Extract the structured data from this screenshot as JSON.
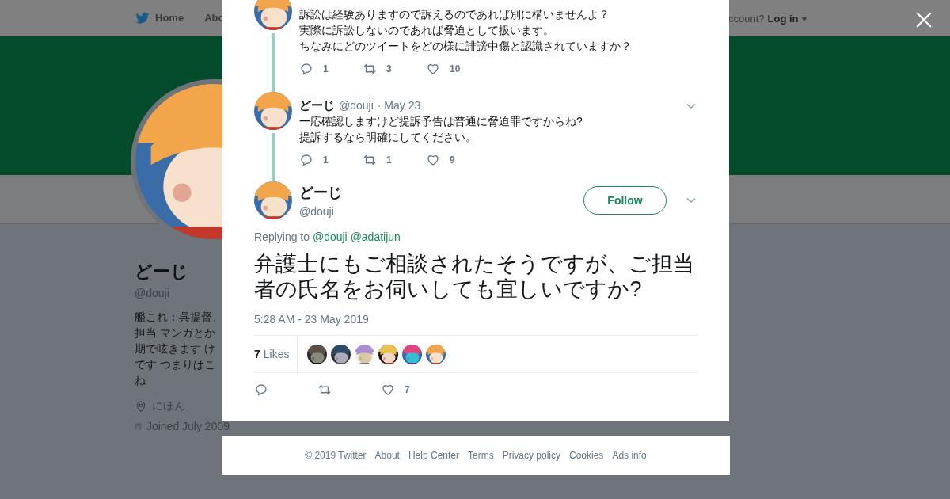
{
  "nav": {
    "items": [
      {
        "label": "Home"
      },
      {
        "label": "Abo"
      }
    ],
    "account_prompt": "ccount?",
    "login": "Log in"
  },
  "profile": {
    "name": "どーじ",
    "handle": "@douji",
    "bio": [
      "艦これ：呉提督、",
      "担当 マンガとか",
      "期で呟きます け",
      "です つまりはこ",
      "ね"
    ],
    "location": "にほん",
    "joined": "Joined July 2009"
  },
  "thread": [
    {
      "text": [
        "訴訟は経験ありますので訴えるのであれば別に構いませんよ？",
        "実際に訴訟しないのであれば脅迫として扱います。",
        "ちなみにどのツイートをどの様に誹謗中傷と認識されていますか？"
      ],
      "replies": "1",
      "retweets": "3",
      "likes": "10"
    },
    {
      "name": "どーじ",
      "handle": "@douji",
      "date": "· May 23",
      "text": [
        "一応確認しますけど提訴予告は普通に脅迫罪ですからね?",
        "提訴するなら明確にしてください。"
      ],
      "replies": "1",
      "retweets": "1",
      "likes": "9"
    }
  ],
  "tweet": {
    "name": "どーじ",
    "handle": "@douji",
    "follow": "Follow",
    "replying_label": "Replying to",
    "mentions": [
      "@douji",
      "@adatijun"
    ],
    "text": "弁護士にもご相談されたそうですが、ご担当者の氏名をお伺いしても宜しいですか?",
    "timestamp": "5:28 AM - 23 May 2019",
    "likes_count": "7",
    "likes_label": "Likes",
    "likers": [
      {
        "kind": "picture"
      },
      {
        "kind": "picture"
      },
      {
        "kind": "picture"
      },
      {
        "kind": "picture"
      },
      {
        "kind": "picture"
      },
      {
        "kind": "picture"
      }
    ],
    "likes": "7"
  },
  "footer": [
    "© 2019 Twitter",
    "About",
    "Help Center",
    "Terms",
    "Privacy policy",
    "Cookies",
    "Ads info"
  ]
}
